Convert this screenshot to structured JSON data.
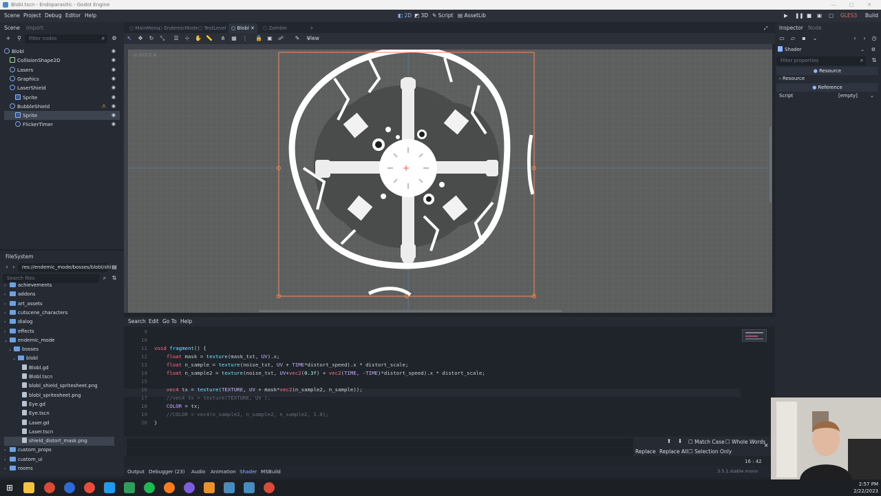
{
  "window": {
    "title": "Blobl.tscn - Endoparasitic - Godot Engine",
    "min": "—",
    "max": "□",
    "close": "✕"
  },
  "menubar": {
    "items": [
      "Scene",
      "Project",
      "Debug",
      "Editor",
      "Help"
    ],
    "workspaces": [
      "2D",
      "3D",
      "Script",
      "AssetLib"
    ],
    "renderer": "GLES3",
    "build": "Build"
  },
  "scene_dock": {
    "tabs": [
      "Scene",
      "Import"
    ],
    "filter_placeholder": "Filter nodes",
    "nodes": [
      {
        "label": "Blobl",
        "depth": 0,
        "kind": "root"
      },
      {
        "label": "CollisionShape2D",
        "depth": 1,
        "kind": "shape"
      },
      {
        "label": "Lasers",
        "depth": 1,
        "kind": "node"
      },
      {
        "label": "Graphics",
        "depth": 1,
        "kind": "node"
      },
      {
        "label": "LaserShield",
        "depth": 1,
        "kind": "node"
      },
      {
        "label": "Sprite",
        "depth": 2,
        "kind": "sprite"
      },
      {
        "label": "BubbleShield",
        "depth": 1,
        "kind": "root",
        "warn": true
      },
      {
        "label": "Sprite",
        "depth": 2,
        "kind": "sprite",
        "selected": true
      },
      {
        "label": "FlickerTimer",
        "depth": 2,
        "kind": "timer"
      }
    ]
  },
  "filesystem": {
    "title": "FileSystem",
    "path": "res://endemic_mode/bosses/blobl/shi",
    "search_placeholder": "Search files",
    "items": [
      {
        "label": "achievements",
        "depth": 1,
        "type": "folder",
        "arrow": "›"
      },
      {
        "label": "addons",
        "depth": 1,
        "type": "folder",
        "arrow": "›"
      },
      {
        "label": "art_assets",
        "depth": 1,
        "type": "folder",
        "arrow": "›"
      },
      {
        "label": "cutscene_characters",
        "depth": 1,
        "type": "folder",
        "arrow": "›"
      },
      {
        "label": "dialog",
        "depth": 1,
        "type": "folder",
        "arrow": "›"
      },
      {
        "label": "effects",
        "depth": 1,
        "type": "folder",
        "arrow": "›"
      },
      {
        "label": "endemic_mode",
        "depth": 1,
        "type": "folder",
        "arrow": "⌄"
      },
      {
        "label": "bosses",
        "depth": 2,
        "type": "folder",
        "arrow": "⌄"
      },
      {
        "label": "blobl",
        "depth": 3,
        "type": "folder",
        "arrow": "⌄"
      },
      {
        "label": "Blobl.gd",
        "depth": 4,
        "type": "file"
      },
      {
        "label": "Blobl.tscn",
        "depth": 4,
        "type": "file"
      },
      {
        "label": "blobl_shield_spritesheet.png",
        "depth": 4,
        "type": "file"
      },
      {
        "label": "blobl_spritesheet.png",
        "depth": 4,
        "type": "file"
      },
      {
        "label": "Eye.gd",
        "depth": 4,
        "type": "file"
      },
      {
        "label": "Eye.tscn",
        "depth": 4,
        "type": "file"
      },
      {
        "label": "Laser.gd",
        "depth": 4,
        "type": "file"
      },
      {
        "label": "Laser.tscn",
        "depth": 4,
        "type": "file"
      },
      {
        "label": "shield_distort_mask.png",
        "depth": 4,
        "type": "file",
        "selected": true
      },
      {
        "label": "custom_props",
        "depth": 1,
        "type": "folder",
        "arrow": "›"
      },
      {
        "label": "custom_ui",
        "depth": 1,
        "type": "folder",
        "arrow": "›"
      },
      {
        "label": "rooms",
        "depth": 1,
        "type": "folder",
        "arrow": "›"
      }
    ]
  },
  "scene_tabs": [
    "MainMenu",
    "EndemicMode",
    "TestLevel",
    "Blobl",
    "Zombie"
  ],
  "active_scene_tab": "Blobl",
  "viewport_toolbar": {
    "view_label": "View"
  },
  "viewport": {
    "zoom_label": "203.5"
  },
  "script_menu": [
    "Search",
    "Edit",
    "Go To",
    "Help"
  ],
  "code_lines": [
    {
      "n": "9",
      "t": ""
    },
    {
      "n": "10",
      "t": ""
    },
    {
      "n": "11",
      "t": "void fragment() {"
    },
    {
      "n": "12",
      "t": "    float mask = texture(mask_txt, UV).x;"
    },
    {
      "n": "13",
      "t": "    float n_sample = texture(noise_txt, UV + TIME*distort_speed).x * distort_scale;"
    },
    {
      "n": "14",
      "t": "    float n_sample2 = texture(noise_txt, UV+vec2(0.3f) + vec2(TIME, -TIME)*distort_speed).x * distort_scale;"
    },
    {
      "n": "15",
      "t": ""
    },
    {
      "n": "16",
      "t": "    vec4 tx = texture(TEXTURE, UV + mask*vec2(n_sample2, n_sample));"
    },
    {
      "n": "17",
      "t": "    //vec4 tx = texture(TEXTURE, UV );"
    },
    {
      "n": "18",
      "t": "    COLOR = tx;"
    },
    {
      "n": "19",
      "t": "    //COLOR = vec4(n_sample2, n_sample2, n_sample2, 1.0);"
    },
    {
      "n": "20",
      "t": "}"
    }
  ],
  "findbar": {
    "match_case": "Match Case",
    "whole_words": "Whole Words",
    "replace": "Replace",
    "replace_all": "Replace All",
    "selection_only": "Selection Only"
  },
  "cursor_pos": "16 :   42",
  "bottom_tabs": [
    "Output",
    "Debugger (23)",
    "Audio",
    "Animation",
    "Shader",
    "MSBuild"
  ],
  "active_bottom_tab": "Shader",
  "version": "3.5.1.stable.mono",
  "inspector": {
    "tabs": [
      "Inspector",
      "Node"
    ],
    "object": "Shader",
    "filter_placeholder": "Filter properties",
    "section_resource": "Resource",
    "resource_row": "Resource",
    "section_reference": "Reference",
    "script_label": "Script",
    "script_value": "[empty]"
  },
  "clock": {
    "time": "2:57 PM",
    "date": "2/22/2023"
  },
  "colors": {
    "accent": "#8fb7ff",
    "viewport_bg": "#5d5e5e",
    "selection_outline": "#ff8a50"
  }
}
